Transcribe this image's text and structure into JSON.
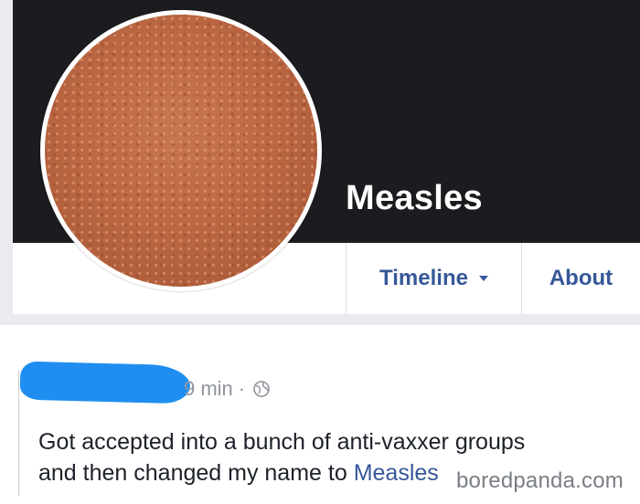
{
  "profile": {
    "name": "Measles",
    "tabs": [
      {
        "label": "Timeline"
      },
      {
        "label": "About"
      }
    ]
  },
  "post": {
    "time": "9 min",
    "separator": "·",
    "text_line1": "Got accepted into a bunch of anti-vaxxer groups",
    "text_line2_prefix": "and then changed my name to ",
    "text_line2_mention": "Measles"
  },
  "watermark": "boredpanda.com",
  "colors": {
    "link": "#365899",
    "cover": "#1b1c1f",
    "redaction": "#1f8ef0"
  },
  "icons": {
    "privacy": "globe-icon",
    "tab_menu": "caret-down-icon"
  }
}
